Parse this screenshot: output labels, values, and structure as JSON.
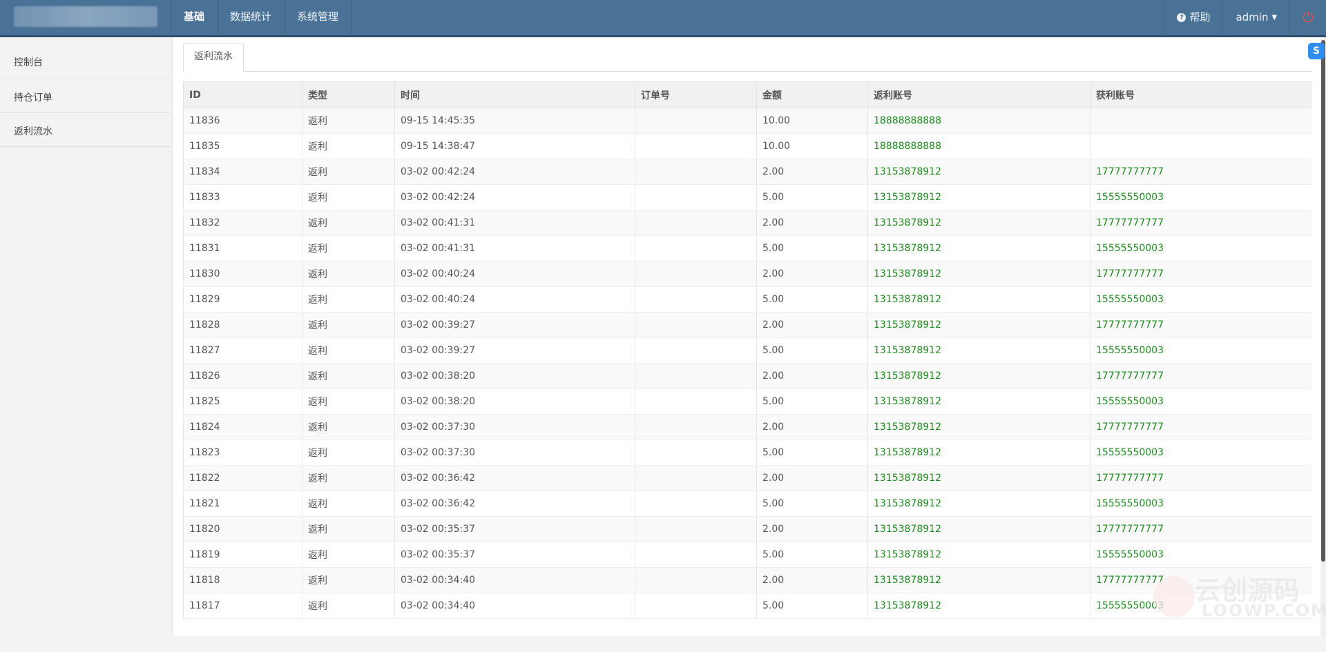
{
  "navbar": {
    "items": [
      "基础",
      "数据统计",
      "系统管理"
    ],
    "help_label": "帮助",
    "user_label": "admin"
  },
  "sidebar": {
    "items": [
      "控制台",
      "持仓订单",
      "返利流水"
    ]
  },
  "tab": {
    "label": "返利流水"
  },
  "table": {
    "headers": [
      "ID",
      "类型",
      "时间",
      "订单号",
      "金额",
      "返利账号",
      "获利账号"
    ],
    "rows": [
      [
        "11836",
        "返利",
        "09-15 14:45:35",
        "",
        "10.00",
        "18888888888",
        ""
      ],
      [
        "11835",
        "返利",
        "09-15 14:38:47",
        "",
        "10.00",
        "18888888888",
        ""
      ],
      [
        "11834",
        "返利",
        "03-02 00:42:24",
        "",
        "2.00",
        "13153878912",
        "17777777777"
      ],
      [
        "11833",
        "返利",
        "03-02 00:42:24",
        "",
        "5.00",
        "13153878912",
        "15555550003"
      ],
      [
        "11832",
        "返利",
        "03-02 00:41:31",
        "",
        "2.00",
        "13153878912",
        "17777777777"
      ],
      [
        "11831",
        "返利",
        "03-02 00:41:31",
        "",
        "5.00",
        "13153878912",
        "15555550003"
      ],
      [
        "11830",
        "返利",
        "03-02 00:40:24",
        "",
        "2.00",
        "13153878912",
        "17777777777"
      ],
      [
        "11829",
        "返利",
        "03-02 00:40:24",
        "",
        "5.00",
        "13153878912",
        "15555550003"
      ],
      [
        "11828",
        "返利",
        "03-02 00:39:27",
        "",
        "2.00",
        "13153878912",
        "17777777777"
      ],
      [
        "11827",
        "返利",
        "03-02 00:39:27",
        "",
        "5.00",
        "13153878912",
        "15555550003"
      ],
      [
        "11826",
        "返利",
        "03-02 00:38:20",
        "",
        "2.00",
        "13153878912",
        "17777777777"
      ],
      [
        "11825",
        "返利",
        "03-02 00:38:20",
        "",
        "5.00",
        "13153878912",
        "15555550003"
      ],
      [
        "11824",
        "返利",
        "03-02 00:37:30",
        "",
        "2.00",
        "13153878912",
        "17777777777"
      ],
      [
        "11823",
        "返利",
        "03-02 00:37:30",
        "",
        "5.00",
        "13153878912",
        "15555550003"
      ],
      [
        "11822",
        "返利",
        "03-02 00:36:42",
        "",
        "2.00",
        "13153878912",
        "17777777777"
      ],
      [
        "11821",
        "返利",
        "03-02 00:36:42",
        "",
        "5.00",
        "13153878912",
        "15555550003"
      ],
      [
        "11820",
        "返利",
        "03-02 00:35:37",
        "",
        "2.00",
        "13153878912",
        "17777777777"
      ],
      [
        "11819",
        "返利",
        "03-02 00:35:37",
        "",
        "5.00",
        "13153878912",
        "15555550003"
      ],
      [
        "11818",
        "返利",
        "03-02 00:34:40",
        "",
        "2.00",
        "13153878912",
        "17777777777"
      ],
      [
        "11817",
        "返利",
        "03-02 00:34:40",
        "",
        "5.00",
        "13153878912",
        "15555550003"
      ]
    ]
  },
  "colors": {
    "navbar_bg": "#4a7196",
    "account_text": "#1e8a1e",
    "power_icon": "#e05252"
  },
  "icons": {
    "help": "question-circle-icon",
    "user_dropdown": "caret-down-icon",
    "logout": "power-icon"
  },
  "watermark": {
    "text": "云创源码",
    "subtext": "LOOWP.COM"
  }
}
